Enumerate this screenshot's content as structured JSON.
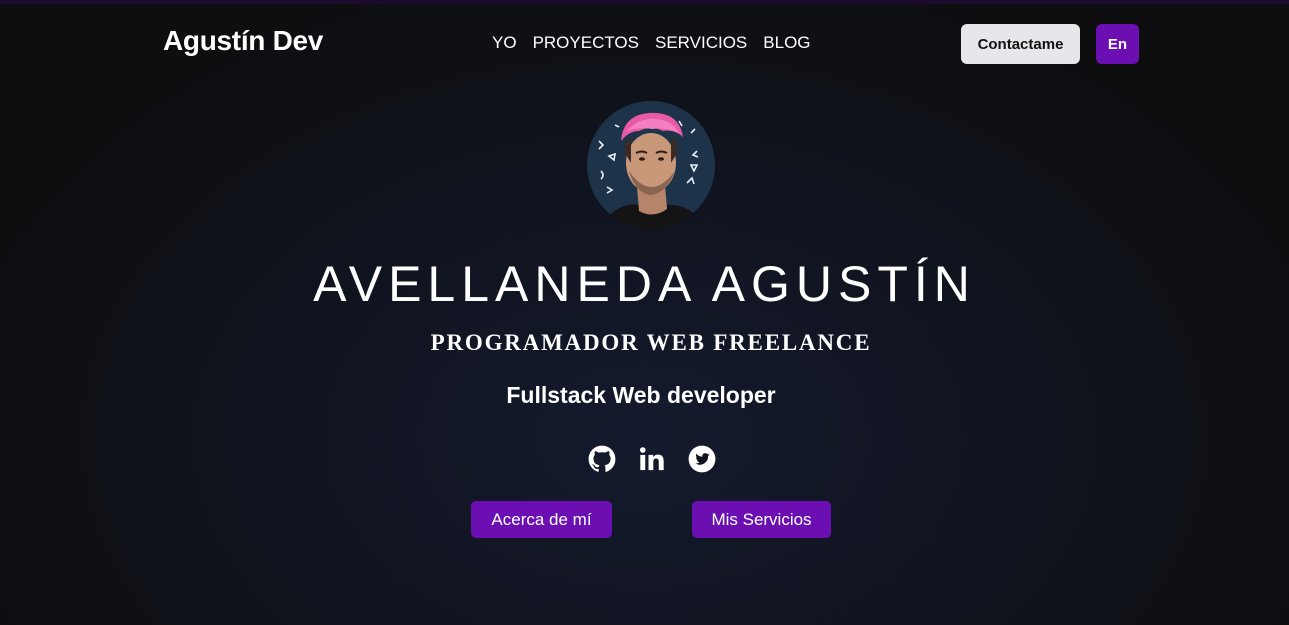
{
  "header": {
    "logo": "Agustín Dev",
    "nav": [
      "YO",
      "PROYECTOS",
      "SERVICIOS",
      "BLOG"
    ],
    "contact_label": "Contactame",
    "lang_label": "En"
  },
  "hero": {
    "name": "AVELLANEDA AGUSTÍN",
    "role": "PROGRAMADOR WEB FREELANCE",
    "subtitle": "Fullstack Web developer",
    "social_icons": [
      "github-icon",
      "linkedin-icon",
      "twitter-icon"
    ],
    "buttons": {
      "about": "Acerca de mí",
      "services": "Mis Servicios"
    }
  },
  "colors": {
    "accent": "#6b0fb3",
    "contact_bg": "#e5e7eb",
    "background": "#10131d",
    "hair": "#e85aa6"
  }
}
